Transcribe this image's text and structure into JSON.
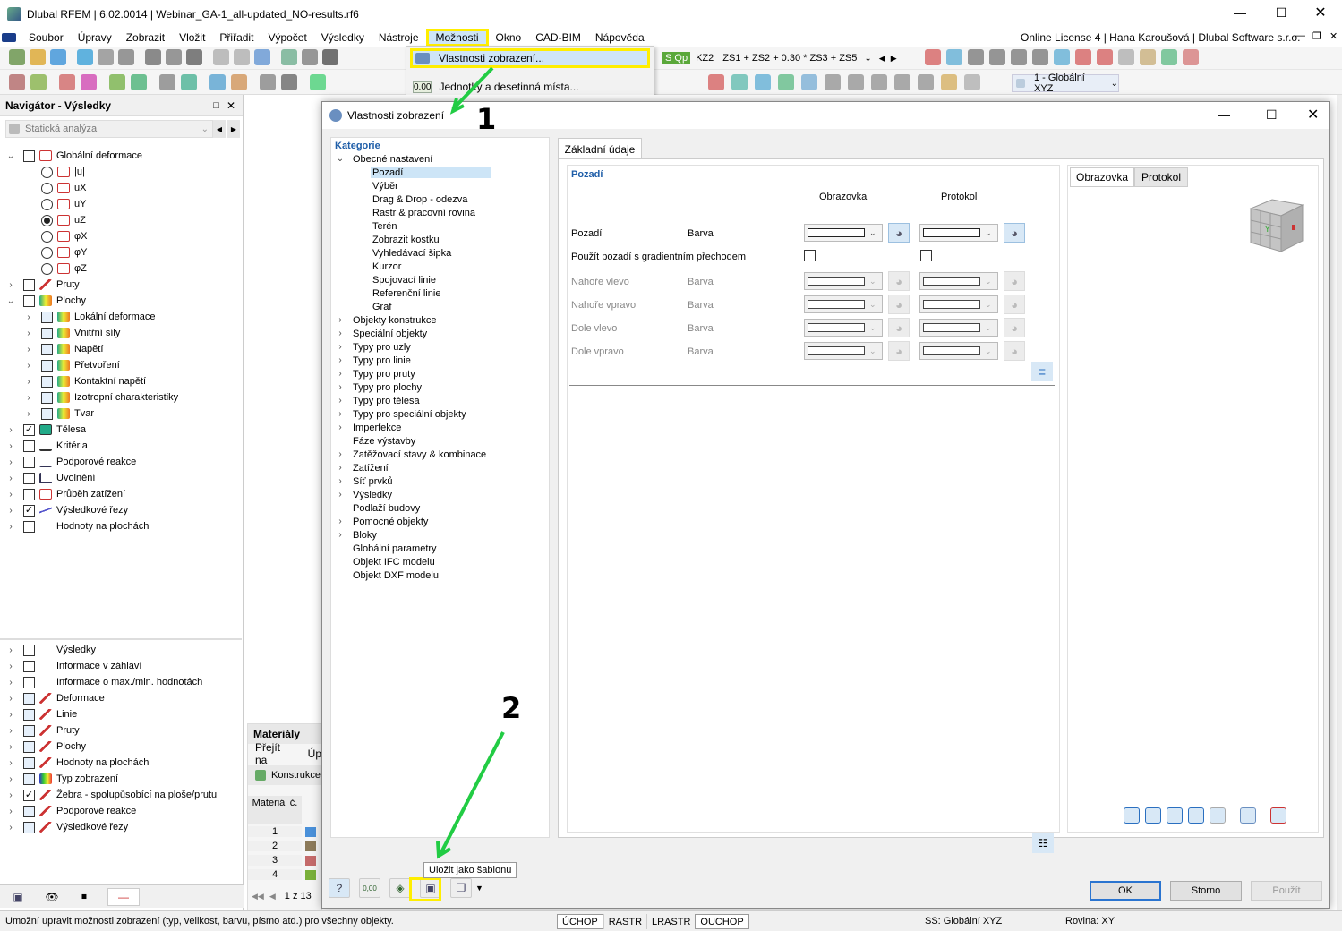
{
  "app": {
    "title": "Dlubal RFEM | 6.02.0014 | Webinar_GA-1_all-updated_NO-results.rf6",
    "license": "Online License 4 | Hana Karoušová | Dlubal Software s.r.o."
  },
  "menu": {
    "items": [
      "Soubor",
      "Úpravy",
      "Zobrazit",
      "Vložit",
      "Přiřadit",
      "Výpočet",
      "Výsledky",
      "Nástroje",
      "Možnosti",
      "Okno",
      "CAD-BIM",
      "Nápověda"
    ],
    "dropdown": [
      "Vlastnosti zobrazení...",
      "Jednotky a desetinná místa..."
    ]
  },
  "toolbar": {
    "load_badge": "S Qp",
    "combo_label": "KZ2",
    "combo_formula": "ZS1 + ZS2 + 0.30 * ZS3 + ZS5",
    "coord_system": "1 - Globální XYZ"
  },
  "navigator": {
    "title": "Navigátor - Výsledky",
    "analysis": "Statická analýza",
    "tree": [
      {
        "lvl": 0,
        "tw": "v",
        "chk": "box",
        "label": "Globální deformace",
        "icon": "deform"
      },
      {
        "lvl": 1,
        "chk": "radio",
        "label": "|u|",
        "icon": "deform"
      },
      {
        "lvl": 1,
        "chk": "radio",
        "label": "uX",
        "icon": "deform"
      },
      {
        "lvl": 1,
        "chk": "radio",
        "label": "uY",
        "icon": "deform"
      },
      {
        "lvl": 1,
        "chk": "radio-on",
        "label": "uZ",
        "icon": "deform"
      },
      {
        "lvl": 1,
        "chk": "radio",
        "label": "φX",
        "icon": "deform"
      },
      {
        "lvl": 1,
        "chk": "radio",
        "label": "φY",
        "icon": "deform"
      },
      {
        "lvl": 1,
        "chk": "radio",
        "label": "φZ",
        "icon": "deform"
      },
      {
        "lvl": 0,
        "tw": ">",
        "chk": "box",
        "label": "Pruty",
        "icon": "member"
      },
      {
        "lvl": 0,
        "tw": "v",
        "chk": "box",
        "label": "Plochy",
        "icon": "surface"
      },
      {
        "lvl": 1,
        "tw": ">",
        "chk": "box-blue",
        "label": "Lokální deformace",
        "icon": "surface"
      },
      {
        "lvl": 1,
        "tw": ">",
        "chk": "box-blue",
        "label": "Vnitřní síly",
        "icon": "surface"
      },
      {
        "lvl": 1,
        "tw": ">",
        "chk": "box-blue",
        "label": "Napětí",
        "icon": "surface"
      },
      {
        "lvl": 1,
        "tw": ">",
        "chk": "box-blue",
        "label": "Přetvoření",
        "icon": "surface"
      },
      {
        "lvl": 1,
        "tw": ">",
        "chk": "box-blue",
        "label": "Kontaktní napětí",
        "icon": "surface"
      },
      {
        "lvl": 1,
        "tw": ">",
        "chk": "box-blue",
        "label": "Izotropní charakteristiky",
        "icon": "surface"
      },
      {
        "lvl": 1,
        "tw": ">",
        "chk": "box-blue",
        "label": "Tvar",
        "icon": "surface"
      },
      {
        "lvl": 0,
        "tw": ">",
        "chk": "checked",
        "label": "Tělesa",
        "icon": "solid"
      },
      {
        "lvl": 0,
        "tw": ">",
        "chk": "box",
        "label": "Kritéria",
        "icon": "line"
      },
      {
        "lvl": 0,
        "tw": ">",
        "chk": "box",
        "label": "Podporové reakce",
        "icon": "support"
      },
      {
        "lvl": 0,
        "tw": ">",
        "chk": "box",
        "label": "Uvolnění",
        "icon": "release"
      },
      {
        "lvl": 0,
        "tw": ">",
        "chk": "box",
        "label": "Průběh zatížení",
        "icon": "deform"
      },
      {
        "lvl": 0,
        "tw": ">",
        "chk": "checked",
        "label": "Výsledkové řezy",
        "icon": "section"
      },
      {
        "lvl": 0,
        "tw": ">",
        "chk": "box",
        "label": "Hodnoty na plochách",
        "icon": "values"
      }
    ],
    "tree2": [
      {
        "chk": "box",
        "label": "Výsledky",
        "icon": "values"
      },
      {
        "chk": "box",
        "label": "Informace v záhlaví",
        "icon": "none"
      },
      {
        "chk": "box",
        "label": "Informace o max./min. hodnotách",
        "icon": "none"
      },
      {
        "chk": "box-blue",
        "label": "Deformace",
        "icon": "member"
      },
      {
        "chk": "box-blue",
        "label": "Linie",
        "icon": "member"
      },
      {
        "chk": "box-blue",
        "label": "Pruty",
        "icon": "member"
      },
      {
        "chk": "box-blue",
        "label": "Plochy",
        "icon": "member"
      },
      {
        "chk": "box-blue",
        "label": "Hodnoty na plochách",
        "icon": "member"
      },
      {
        "chk": "box-blue",
        "label": "Typ zobrazení",
        "icon": "rainbow"
      },
      {
        "chk": "checked",
        "label": "Žebra - spolupůsobící na ploše/prutu",
        "icon": "member"
      },
      {
        "chk": "box-blue",
        "label": "Podporové reakce",
        "icon": "member"
      },
      {
        "chk": "box-blue",
        "label": "Výsledkové řezy",
        "icon": "member"
      }
    ]
  },
  "materials": {
    "title": "Materiály",
    "goto": "Přejít na",
    "edit": "Úp",
    "construct": "Konstrukce",
    "col_header": "Materiál č.",
    "rows": [
      "1",
      "2",
      "3",
      "4"
    ],
    "row_colors": [
      "#4a90d9",
      "#8c7a5a",
      "#c46a6a",
      "#7ab03a"
    ],
    "pager": "1 z 13"
  },
  "dialog": {
    "title": "Vlastnosti zobrazení",
    "category_header": "Kategorie",
    "categories": [
      {
        "lvl": 0,
        "tw": "v",
        "label": "Obecné nastavení"
      },
      {
        "lvl": 1,
        "label": "Pozadí",
        "sel": true
      },
      {
        "lvl": 1,
        "label": "Výběr"
      },
      {
        "lvl": 1,
        "label": "Drag & Drop - odezva"
      },
      {
        "lvl": 1,
        "label": "Rastr & pracovní rovina"
      },
      {
        "lvl": 1,
        "label": "Terén"
      },
      {
        "lvl": 1,
        "label": "Zobrazit kostku"
      },
      {
        "lvl": 1,
        "label": "Vyhledávací šipka"
      },
      {
        "lvl": 1,
        "label": "Kurzor"
      },
      {
        "lvl": 1,
        "label": "Spojovací linie"
      },
      {
        "lvl": 1,
        "label": "Referenční linie"
      },
      {
        "lvl": 1,
        "label": "Graf"
      },
      {
        "lvl": 0,
        "tw": ">",
        "label": "Objekty konstrukce"
      },
      {
        "lvl": 0,
        "tw": ">",
        "label": "Speciální objekty"
      },
      {
        "lvl": 0,
        "tw": ">",
        "label": "Typy pro uzly"
      },
      {
        "lvl": 0,
        "tw": ">",
        "label": "Typy pro linie"
      },
      {
        "lvl": 0,
        "tw": ">",
        "label": "Typy pro pruty"
      },
      {
        "lvl": 0,
        "tw": ">",
        "label": "Typy pro plochy"
      },
      {
        "lvl": 0,
        "tw": ">",
        "label": "Typy pro tělesa"
      },
      {
        "lvl": 0,
        "tw": ">",
        "label": "Typy pro speciální objekty"
      },
      {
        "lvl": 0,
        "tw": ">",
        "label": "Imperfekce"
      },
      {
        "lvl": 0,
        "label": "Fáze výstavby"
      },
      {
        "lvl": 0,
        "tw": ">",
        "label": "Zatěžovací stavy & kombinace"
      },
      {
        "lvl": 0,
        "tw": ">",
        "label": "Zatížení"
      },
      {
        "lvl": 0,
        "tw": ">",
        "label": "Síť prvků"
      },
      {
        "lvl": 0,
        "tw": ">",
        "label": "Výsledky"
      },
      {
        "lvl": 0,
        "label": "Podlaží budovy"
      },
      {
        "lvl": 0,
        "tw": ">",
        "label": "Pomocné objekty"
      },
      {
        "lvl": 0,
        "tw": ">",
        "label": "Bloky"
      },
      {
        "lvl": 0,
        "label": "Globální parametry"
      },
      {
        "lvl": 0,
        "label": "Objekt IFC modelu"
      },
      {
        "lvl": 0,
        "label": "Objekt DXF modelu"
      }
    ],
    "tab": "Základní údaje",
    "section": "Pozadí",
    "col_screen": "Obrazovka",
    "col_report": "Protokol",
    "rows": [
      {
        "label": "Pozadí",
        "sub": "Barva",
        "enabled": true
      },
      {
        "label": "Nahoře vlevo",
        "sub": "Barva",
        "enabled": false
      },
      {
        "label": "Nahoře vpravo",
        "sub": "Barva",
        "enabled": false
      },
      {
        "label": "Dole vlevo",
        "sub": "Barva",
        "enabled": false
      },
      {
        "label": "Dole vpravo",
        "sub": "Barva",
        "enabled": false
      }
    ],
    "gradient_label": "Použít pozadí s gradientním přechodem",
    "preview_tabs": [
      "Obrazovka",
      "Protokol"
    ],
    "tooltip": "Uložit jako šablonu",
    "ok": "OK",
    "cancel": "Storno",
    "apply": "Použít",
    "units_icon_text": "0,00"
  },
  "annotations": {
    "step1": "1",
    "step2": "2",
    "arrow_color": "#22cc44",
    "highlight_color": "#ffee00"
  },
  "statusbar": {
    "message": "Umožní upravit možnosti zobrazení (typ, velikost, barvu, písmo atd.) pro všechny objekty.",
    "modes": [
      "ÚCHOP",
      "RASTR",
      "LRASTR",
      "OUCHOP"
    ],
    "cs": "SS: Globální XYZ",
    "plane": "Rovina: XY"
  }
}
